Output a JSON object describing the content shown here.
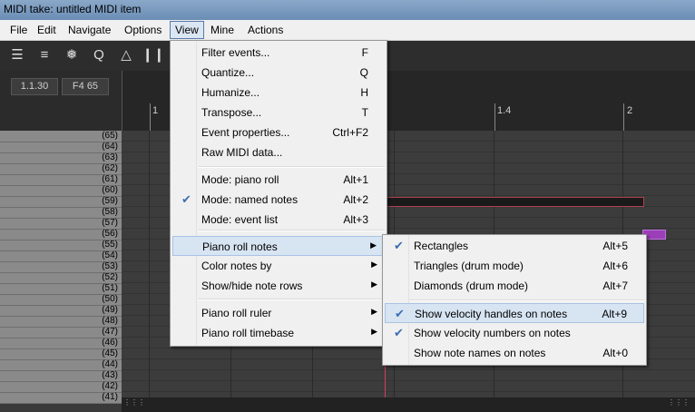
{
  "window": {
    "title": "MIDI take: untitled MIDI item"
  },
  "menubar": [
    {
      "label": "File"
    },
    {
      "label": "Edit"
    },
    {
      "label": "Navigate"
    },
    {
      "label": "Options"
    },
    {
      "label": "View"
    },
    {
      "label": "Mine"
    },
    {
      "label": "Actions"
    }
  ],
  "toolbar": {
    "icons": [
      "list-view-icon",
      "align-icon",
      "dice-icon",
      "quantize-icon",
      "triangle-icon",
      "bars-icon"
    ]
  },
  "info": {
    "position": "1.1.30",
    "note": "F4  65"
  },
  "ruler": {
    "marks": [
      "1",
      "1.4",
      "2"
    ]
  },
  "keyboard": {
    "rows": [
      "(65)",
      "(64)",
      "(63)",
      "(62)",
      "(61)",
      "(60)",
      "(59)",
      "(58)",
      "(57)",
      "(56)",
      "(55)",
      "(54)",
      "(53)",
      "(52)",
      "(51)",
      "(50)",
      "(49)",
      "(48)",
      "(47)",
      "(46)",
      "(45)",
      "(44)",
      "(43)",
      "(42)",
      "(41)"
    ]
  },
  "view_menu": {
    "items": [
      {
        "label": "Filter events...",
        "shortcut": "F"
      },
      {
        "label": "Quantize...",
        "shortcut": "Q"
      },
      {
        "label": "Humanize...",
        "shortcut": "H"
      },
      {
        "label": "Transpose...",
        "shortcut": "T"
      },
      {
        "label": "Event properties...",
        "shortcut": "Ctrl+F2"
      },
      {
        "label": "Raw MIDI data...",
        "shortcut": ""
      },
      {
        "label": "Mode: piano roll",
        "shortcut": "Alt+1"
      },
      {
        "label": "Mode: named notes",
        "shortcut": "Alt+2",
        "checked": true
      },
      {
        "label": "Mode: event list",
        "shortcut": "Alt+3"
      },
      {
        "label": "Piano roll notes",
        "submenu": true,
        "highlighted": true
      },
      {
        "label": "Color notes by",
        "submenu": true
      },
      {
        "label": "Show/hide note rows",
        "submenu": true
      },
      {
        "label": "Piano roll ruler",
        "submenu": true
      },
      {
        "label": "Piano roll timebase",
        "submenu": true
      }
    ]
  },
  "notes_submenu": {
    "items": [
      {
        "label": "Rectangles",
        "shortcut": "Alt+5",
        "checked": true
      },
      {
        "label": "Triangles (drum mode)",
        "shortcut": "Alt+6"
      },
      {
        "label": "Diamonds (drum mode)",
        "shortcut": "Alt+7"
      },
      {
        "label": "Show velocity handles on notes",
        "shortcut": "Alt+9",
        "checked": true,
        "highlighted": true
      },
      {
        "label": "Show velocity numbers on notes",
        "shortcut": "",
        "checked": true
      },
      {
        "label": "Show note names on notes",
        "shortcut": "Alt+0"
      }
    ]
  },
  "colors": {
    "note_dark": "#1a1a1a",
    "note_purple": "#9a3fb8",
    "playline": "#d04060",
    "menu_highlight": "#d7e4f2"
  }
}
